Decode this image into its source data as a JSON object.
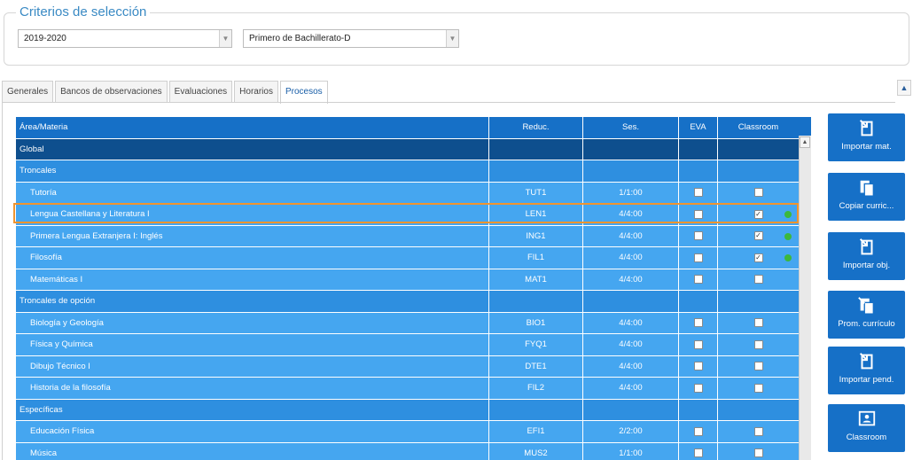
{
  "criteria": {
    "legend": "Criterios de selección",
    "year": "2019-2020",
    "group": "Primero de Bachillerato-D"
  },
  "tabs": [
    {
      "label": "Generales"
    },
    {
      "label": "Bancos de observaciones"
    },
    {
      "label": "Evaluaciones"
    },
    {
      "label": "Horarios"
    },
    {
      "label": "Procesos",
      "active": true
    }
  ],
  "grid": {
    "headers": [
      "Área/Materia",
      "Reduc.",
      "Ses.",
      "EVA",
      "Classroom"
    ],
    "rows": [
      {
        "type": "global",
        "name": "Global"
      },
      {
        "type": "group",
        "name": "Troncales"
      },
      {
        "type": "subj",
        "name": "Tutoría",
        "reduc": "TUT1",
        "ses": "1/1:00",
        "eva": false,
        "classroom": false,
        "dot": false
      },
      {
        "type": "subj",
        "name": "Lengua Castellana y Literatura I",
        "reduc": "LEN1",
        "ses": "4/4:00",
        "eva": false,
        "classroom": true,
        "dot": true,
        "highlighted": true
      },
      {
        "type": "subj",
        "name": "Primera Lengua Extranjera I: Inglés",
        "reduc": "ING1",
        "ses": "4/4:00",
        "eva": false,
        "classroom": true,
        "dot": true
      },
      {
        "type": "subj",
        "name": "Filosofía",
        "reduc": "FIL1",
        "ses": "4/4:00",
        "eva": false,
        "classroom": true,
        "dot": true
      },
      {
        "type": "subj",
        "name": "Matemáticas I",
        "reduc": "MAT1",
        "ses": "4/4:00",
        "eva": false,
        "classroom": false,
        "dot": false
      },
      {
        "type": "group",
        "name": "Troncales de opción"
      },
      {
        "type": "subj",
        "name": "Biología y Geología",
        "reduc": "BIO1",
        "ses": "4/4:00",
        "eva": false,
        "classroom": false,
        "dot": false
      },
      {
        "type": "subj",
        "name": "Física y Química",
        "reduc": "FYQ1",
        "ses": "4/4:00",
        "eva": false,
        "classroom": false,
        "dot": false
      },
      {
        "type": "subj",
        "name": "Dibujo Técnico I",
        "reduc": "DTE1",
        "ses": "4/4:00",
        "eva": false,
        "classroom": false,
        "dot": false
      },
      {
        "type": "subj",
        "name": "Historia de la filosofía",
        "reduc": "FIL2",
        "ses": "4/4:00",
        "eva": false,
        "classroom": false,
        "dot": false
      },
      {
        "type": "group",
        "name": "Específicas"
      },
      {
        "type": "subj",
        "name": "Educación Física",
        "reduc": "EFI1",
        "ses": "2/2:00",
        "eva": false,
        "classroom": false,
        "dot": false
      },
      {
        "type": "subj",
        "name": "Música",
        "reduc": "MUS2",
        "ses": "1/1:00",
        "eva": false,
        "classroom": false,
        "dot": false
      }
    ]
  },
  "actions": [
    {
      "label": "Importar mat.",
      "icon": "import-icon"
    },
    {
      "label": "Copiar curric...",
      "icon": "copy-icon"
    },
    {
      "label": "Importar obj.",
      "icon": "import-icon"
    },
    {
      "label": "Prom. currículo",
      "icon": "promote-icon"
    },
    {
      "label": "Importar pend.",
      "icon": "import-icon"
    },
    {
      "label": "Classroom",
      "icon": "classroom-icon"
    }
  ],
  "colors": {
    "header": "#1670c7",
    "global": "#0e4f8e",
    "group": "#2e8fe0",
    "subject": "#45a6f0",
    "highlight": "#f0942f",
    "status_dot": "#3cb83c"
  }
}
